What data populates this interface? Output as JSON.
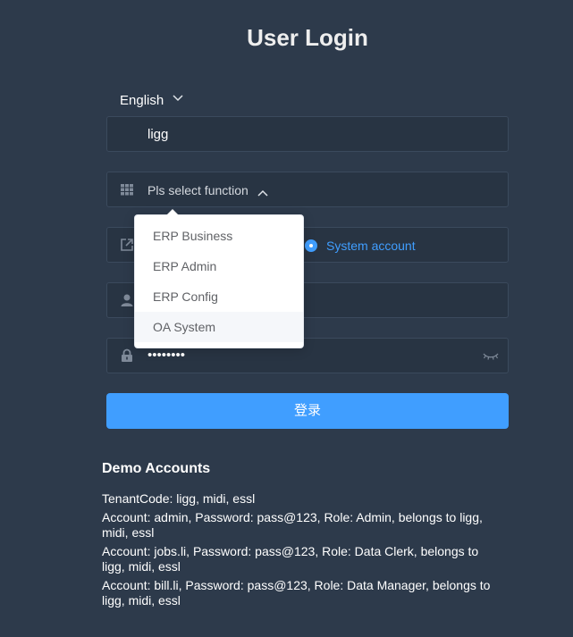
{
  "title": "User Login",
  "language": {
    "selected": "English"
  },
  "tenant": {
    "value": "ligg"
  },
  "function_select": {
    "placeholder": "Pls select function",
    "options": [
      "ERP Business",
      "ERP Admin",
      "ERP Config",
      "OA System"
    ],
    "hovered_option": "OA System"
  },
  "account_type": {
    "selected": "System account"
  },
  "password": {
    "masked_value": "••••••••"
  },
  "login_button": {
    "label": "登录"
  },
  "demo": {
    "heading": "Demo Accounts",
    "lines": [
      "TenantCode: ligg, midi, essl",
      "Account: admin, Password: pass@123, Role: Admin, belongs to ligg, midi, essl",
      "Account: jobs.li, Password: pass@123, Role: Data Clerk, belongs to ligg, midi, essl",
      "Account: bill.li, Password: pass@123, Role: Data Manager, belongs to ligg, midi, essl"
    ]
  },
  "colors": {
    "background": "#2d3a4b",
    "field_background": "#283443",
    "accent": "#409eff"
  }
}
